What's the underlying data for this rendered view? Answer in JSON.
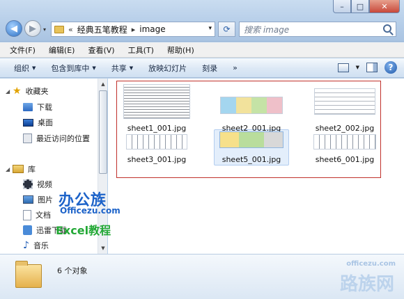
{
  "window": {
    "min_label": "–",
    "max_label": "□",
    "close_label": "✕"
  },
  "nav": {
    "back_glyph": "◀",
    "fwd_glyph": "▶",
    "dropdown_glyph": "▾",
    "chevrons": "«",
    "path": [
      "经典五笔教程",
      "image"
    ],
    "path_sep": "▸",
    "refresh_glyph": "⟳"
  },
  "search": {
    "placeholder": "搜索 image"
  },
  "menu": [
    "文件(F)",
    "编辑(E)",
    "查看(V)",
    "工具(T)",
    "帮助(H)"
  ],
  "toolbar": {
    "items": [
      {
        "label": "组织",
        "arrow": "▼"
      },
      {
        "label": "包含到库中",
        "arrow": "▼"
      },
      {
        "label": "共享",
        "arrow": "▼"
      },
      {
        "label": "放映幻灯片",
        "arrow": ""
      },
      {
        "label": "刻录",
        "arrow": ""
      },
      {
        "label": "»",
        "arrow": ""
      }
    ],
    "help_label": "?"
  },
  "sidebar": {
    "favorites": {
      "label": "收藏夹",
      "items": [
        "下载",
        "桌面",
        "最近访问的位置"
      ]
    },
    "libraries": {
      "label": "库",
      "items": [
        "视频",
        "图片",
        "文档",
        "迅雷下载",
        "音乐"
      ]
    }
  },
  "files": [
    {
      "name": "sheet1_001.jpg",
      "thumb": "doc"
    },
    {
      "name": "sheet2_001.jpg",
      "thumb": "color"
    },
    {
      "name": "sheet2_002.jpg",
      "thumb": "sketch"
    },
    {
      "name": "sheet3_001.jpg",
      "thumb": "kbd"
    },
    {
      "name": "sheet5_001.jpg",
      "thumb": "color2"
    },
    {
      "name": "sheet6_001.jpg",
      "thumb": "kbd"
    }
  ],
  "watermark": {
    "brand": "办公族",
    "url": "Officezu.com",
    "tag": "Excel教程",
    "footer_url": "officezu.com",
    "footer_brand": "路族网"
  },
  "details": {
    "count_text": "6 个对象"
  }
}
